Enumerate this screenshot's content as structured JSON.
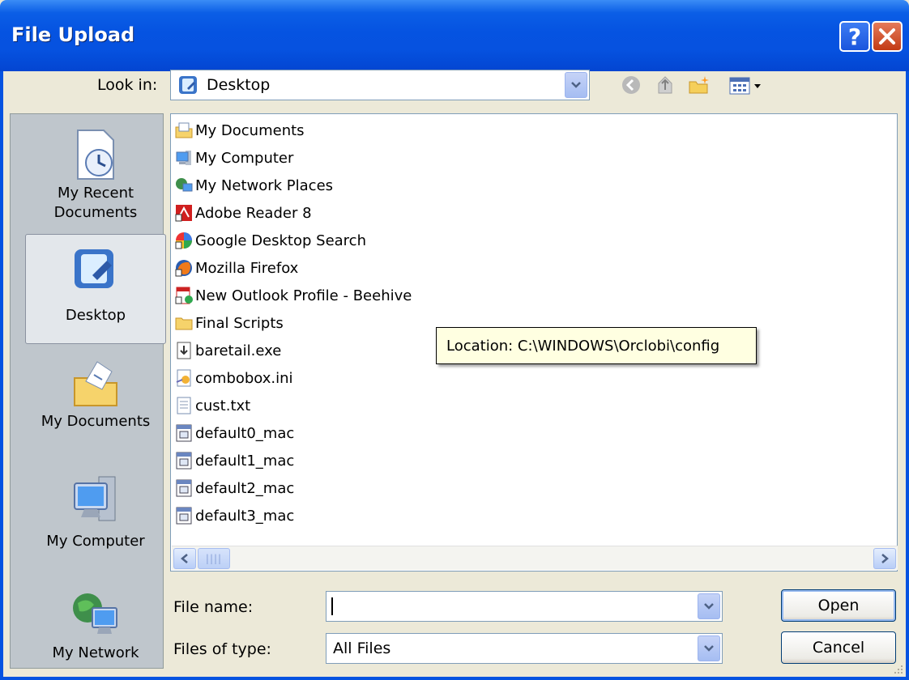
{
  "window": {
    "title": "File Upload"
  },
  "toolbar": {
    "look_in_label": "Look in:",
    "look_in_value": "Desktop"
  },
  "places": [
    {
      "label": "My Recent\nDocuments",
      "icon": "recent-documents-icon"
    },
    {
      "label": "Desktop",
      "icon": "desktop-icon"
    },
    {
      "label": "My Documents",
      "icon": "my-documents-icon"
    },
    {
      "label": "My Computer",
      "icon": "my-computer-icon"
    },
    {
      "label": "My Network",
      "icon": "my-network-icon"
    }
  ],
  "files": [
    {
      "name": "My Documents",
      "icon": "my-documents-icon"
    },
    {
      "name": "My Computer",
      "icon": "my-computer-icon"
    },
    {
      "name": "My Network Places",
      "icon": "network-places-icon"
    },
    {
      "name": "Adobe Reader 8",
      "icon": "adobe-reader-icon"
    },
    {
      "name": "Google Desktop Search",
      "icon": "google-desktop-icon"
    },
    {
      "name": "Mozilla Firefox",
      "icon": "firefox-icon"
    },
    {
      "name": "New Outlook Profile - Beehive",
      "icon": "outlook-profile-icon"
    },
    {
      "name": "Final Scripts",
      "icon": "folder-icon"
    },
    {
      "name": "baretail.exe",
      "icon": "exe-icon"
    },
    {
      "name": "combobox.ini",
      "icon": "ini-icon"
    },
    {
      "name": "cust.txt",
      "icon": "text-file-icon"
    },
    {
      "name": "default0_mac",
      "icon": "mac-file-icon"
    },
    {
      "name": "default1_mac",
      "icon": "mac-file-icon"
    },
    {
      "name": "default2_mac",
      "icon": "mac-file-icon"
    },
    {
      "name": "default3_mac",
      "icon": "mac-file-icon"
    }
  ],
  "tooltip": {
    "text": "Location: C:\\WINDOWS\\Orclobi\\config"
  },
  "form": {
    "file_name_label": "File name:",
    "file_name_value": "",
    "files_of_type_label": "Files of type:",
    "files_of_type_value": "All Files"
  },
  "buttons": {
    "open": "Open",
    "cancel": "Cancel"
  }
}
